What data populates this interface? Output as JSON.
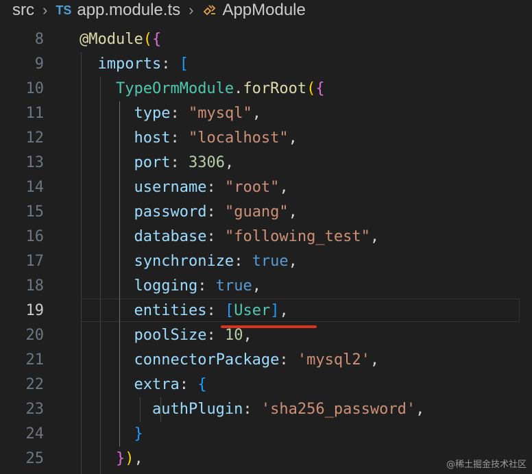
{
  "breadcrumb": {
    "folder": "src",
    "file_badge": "TS",
    "file": "app.module.ts",
    "symbol": "AppModule"
  },
  "editor": {
    "active_line": 19,
    "lines": [
      {
        "n": "8",
        "t": [
          [
            "f",
            "@Module"
          ],
          [
            "br3",
            "("
          ],
          [
            "br1",
            "{"
          ]
        ]
      },
      {
        "n": "9",
        "t": [
          [
            "p",
            "  "
          ],
          [
            "k",
            "imports"
          ],
          [
            "p",
            ": "
          ],
          [
            "br2",
            "["
          ]
        ]
      },
      {
        "n": "10",
        "t": [
          [
            "p",
            "    "
          ],
          [
            "c",
            "TypeOrmModule"
          ],
          [
            "p",
            "."
          ],
          [
            "f",
            "forRoot"
          ],
          [
            "br3",
            "("
          ],
          [
            "br1",
            "{"
          ]
        ]
      },
      {
        "n": "11",
        "t": [
          [
            "p",
            "      "
          ],
          [
            "k",
            "type"
          ],
          [
            "p",
            ": "
          ],
          [
            "s",
            "\"mysql\""
          ],
          [
            "p",
            ","
          ]
        ]
      },
      {
        "n": "12",
        "t": [
          [
            "p",
            "      "
          ],
          [
            "k",
            "host"
          ],
          [
            "p",
            ": "
          ],
          [
            "s",
            "\"localhost\""
          ],
          [
            "p",
            ","
          ]
        ]
      },
      {
        "n": "13",
        "t": [
          [
            "p",
            "      "
          ],
          [
            "k",
            "port"
          ],
          [
            "p",
            ": "
          ],
          [
            "n",
            "3306"
          ],
          [
            "p",
            ","
          ]
        ]
      },
      {
        "n": "14",
        "t": [
          [
            "p",
            "      "
          ],
          [
            "k",
            "username"
          ],
          [
            "p",
            ": "
          ],
          [
            "s",
            "\"root\""
          ],
          [
            "p",
            ","
          ]
        ]
      },
      {
        "n": "15",
        "t": [
          [
            "p",
            "      "
          ],
          [
            "k",
            "password"
          ],
          [
            "p",
            ": "
          ],
          [
            "s",
            "\"guang\""
          ],
          [
            "p",
            ","
          ]
        ]
      },
      {
        "n": "16",
        "t": [
          [
            "p",
            "      "
          ],
          [
            "k",
            "database"
          ],
          [
            "p",
            ": "
          ],
          [
            "s",
            "\"following_test\""
          ],
          [
            "p",
            ","
          ]
        ]
      },
      {
        "n": "17",
        "t": [
          [
            "p",
            "      "
          ],
          [
            "k",
            "synchronize"
          ],
          [
            "p",
            ": "
          ],
          [
            "b",
            "true"
          ],
          [
            "p",
            ","
          ]
        ]
      },
      {
        "n": "18",
        "t": [
          [
            "p",
            "      "
          ],
          [
            "k",
            "logging"
          ],
          [
            "p",
            ": "
          ],
          [
            "b",
            "true"
          ],
          [
            "p",
            ","
          ]
        ]
      },
      {
        "n": "19",
        "t": [
          [
            "p",
            "      "
          ],
          [
            "k",
            "entities"
          ],
          [
            "p",
            ": "
          ],
          [
            "br2",
            "["
          ],
          [
            "c",
            "User"
          ],
          [
            "br2",
            "]"
          ],
          [
            "p",
            ","
          ]
        ]
      },
      {
        "n": "20",
        "t": [
          [
            "p",
            "      "
          ],
          [
            "k",
            "poolSize"
          ],
          [
            "p",
            ": "
          ],
          [
            "n",
            "10"
          ],
          [
            "p",
            ","
          ]
        ]
      },
      {
        "n": "21",
        "t": [
          [
            "p",
            "      "
          ],
          [
            "k",
            "connectorPackage"
          ],
          [
            "p",
            ": "
          ],
          [
            "s",
            "'mysql2'"
          ],
          [
            "p",
            ","
          ]
        ]
      },
      {
        "n": "22",
        "t": [
          [
            "p",
            "      "
          ],
          [
            "k",
            "extra"
          ],
          [
            "p",
            ": "
          ],
          [
            "br2",
            "{"
          ]
        ]
      },
      {
        "n": "23",
        "t": [
          [
            "p",
            "        "
          ],
          [
            "k",
            "authPlugin"
          ],
          [
            "p",
            ": "
          ],
          [
            "s",
            "'sha256_password'"
          ],
          [
            "p",
            ","
          ]
        ]
      },
      {
        "n": "24",
        "t": [
          [
            "p",
            "      "
          ],
          [
            "br2",
            "}"
          ]
        ]
      },
      {
        "n": "25",
        "t": [
          [
            "p",
            "    "
          ],
          [
            "br1",
            "}"
          ],
          [
            "br3",
            ")"
          ],
          [
            "p",
            ","
          ]
        ]
      }
    ]
  },
  "watermark": "@稀土掘金技术社区"
}
